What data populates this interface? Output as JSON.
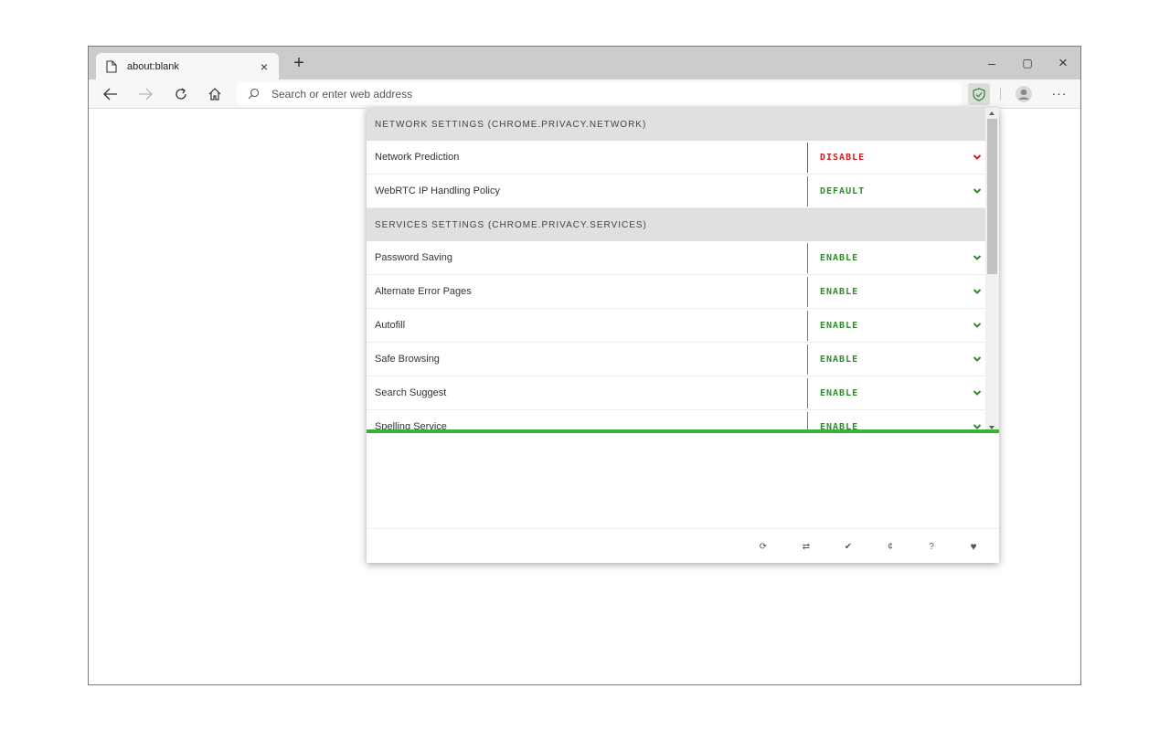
{
  "browser": {
    "tab_title": "about:blank",
    "tab_close_glyph": "×",
    "new_tab_glyph": "+",
    "minimize_glyph": "–",
    "maximize_glyph": "▢",
    "close_glyph": "×",
    "more_glyph": "···",
    "address_placeholder": "Search or enter web address",
    "extension_icon": "shield-check-icon"
  },
  "colors": {
    "enable_green": "#2e8b2e",
    "disable_red": "#cc2020",
    "accent_green": "#39b339"
  },
  "popup": {
    "sections": [
      {
        "title": "NETWORK SETTINGS (CHROME.PRIVACY.NETWORK)",
        "rows": [
          {
            "label": "Network Prediction",
            "value": "DISABLE",
            "state": "red"
          },
          {
            "label": "WebRTC IP Handling Policy",
            "value": "DEFAULT",
            "state": "green"
          }
        ]
      },
      {
        "title": "SERVICES SETTINGS (CHROME.PRIVACY.SERVICES)",
        "rows": [
          {
            "label": "Password Saving",
            "value": "ENABLE",
            "state": "green"
          },
          {
            "label": "Alternate Error Pages",
            "value": "ENABLE",
            "state": "green"
          },
          {
            "label": "Autofill",
            "value": "ENABLE",
            "state": "green"
          },
          {
            "label": "Safe Browsing",
            "value": "ENABLE",
            "state": "green"
          },
          {
            "label": "Search Suggest",
            "value": "ENABLE",
            "state": "green"
          },
          {
            "label": "Spelling Service",
            "value": "ENABLE",
            "state": "green"
          }
        ]
      }
    ],
    "footer": {
      "refresh_glyph": "⟳",
      "swap_glyph": "⇄",
      "check_glyph": "✔",
      "cent_glyph": "¢",
      "help_glyph": "?",
      "heart_glyph": "♥"
    }
  }
}
